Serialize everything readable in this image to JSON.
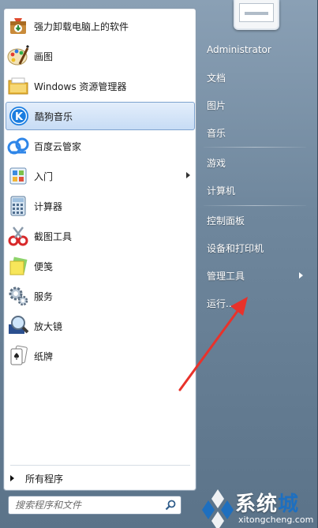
{
  "programs": [
    {
      "label": "强力卸载电脑上的软件",
      "icon": "uninstall-box-icon",
      "submenu": false,
      "selected": false
    },
    {
      "label": "画图",
      "icon": "paint-palette-icon",
      "submenu": false,
      "selected": false
    },
    {
      "label": "Windows 资源管理器",
      "icon": "explorer-folder-icon",
      "submenu": false,
      "selected": false
    },
    {
      "label": "酷狗音乐",
      "icon": "kugou-icon",
      "submenu": false,
      "selected": true
    },
    {
      "label": "百度云管家",
      "icon": "baidu-cloud-icon",
      "submenu": false,
      "selected": false
    },
    {
      "label": "入门",
      "icon": "getting-started-icon",
      "submenu": true,
      "selected": false
    },
    {
      "label": "计算器",
      "icon": "calculator-icon",
      "submenu": false,
      "selected": false
    },
    {
      "label": "截图工具",
      "icon": "snipping-tool-icon",
      "submenu": false,
      "selected": false
    },
    {
      "label": "便笺",
      "icon": "sticky-notes-icon",
      "submenu": false,
      "selected": false
    },
    {
      "label": "服务",
      "icon": "services-gear-icon",
      "submenu": false,
      "selected": false
    },
    {
      "label": "放大镜",
      "icon": "magnifier-icon",
      "submenu": false,
      "selected": false
    },
    {
      "label": "纸牌",
      "icon": "solitaire-cards-icon",
      "submenu": false,
      "selected": false
    }
  ],
  "all_programs_label": "所有程序",
  "search": {
    "placeholder": "搜索程序和文件"
  },
  "right_items": [
    {
      "label": "Administrator",
      "submenu": false
    },
    {
      "label": "文档",
      "submenu": false
    },
    {
      "label": "图片",
      "submenu": false
    },
    {
      "label": "音乐",
      "submenu": false
    },
    {
      "label": "游戏",
      "submenu": false
    },
    {
      "label": "计算机",
      "submenu": false
    },
    {
      "label": "控制面板",
      "submenu": false
    },
    {
      "label": "设备和打印机",
      "submenu": false
    },
    {
      "label": "管理工具",
      "submenu": true
    },
    {
      "label": "运行...",
      "submenu": false
    }
  ],
  "watermark": {
    "text_main": "系统",
    "text_accent": "城",
    "url": "xitongcheng.com"
  },
  "colors": {
    "selected_bg": "#c7dcf5",
    "annotation_arrow": "#e8322b",
    "watermark_accent": "#1e6fbf"
  }
}
